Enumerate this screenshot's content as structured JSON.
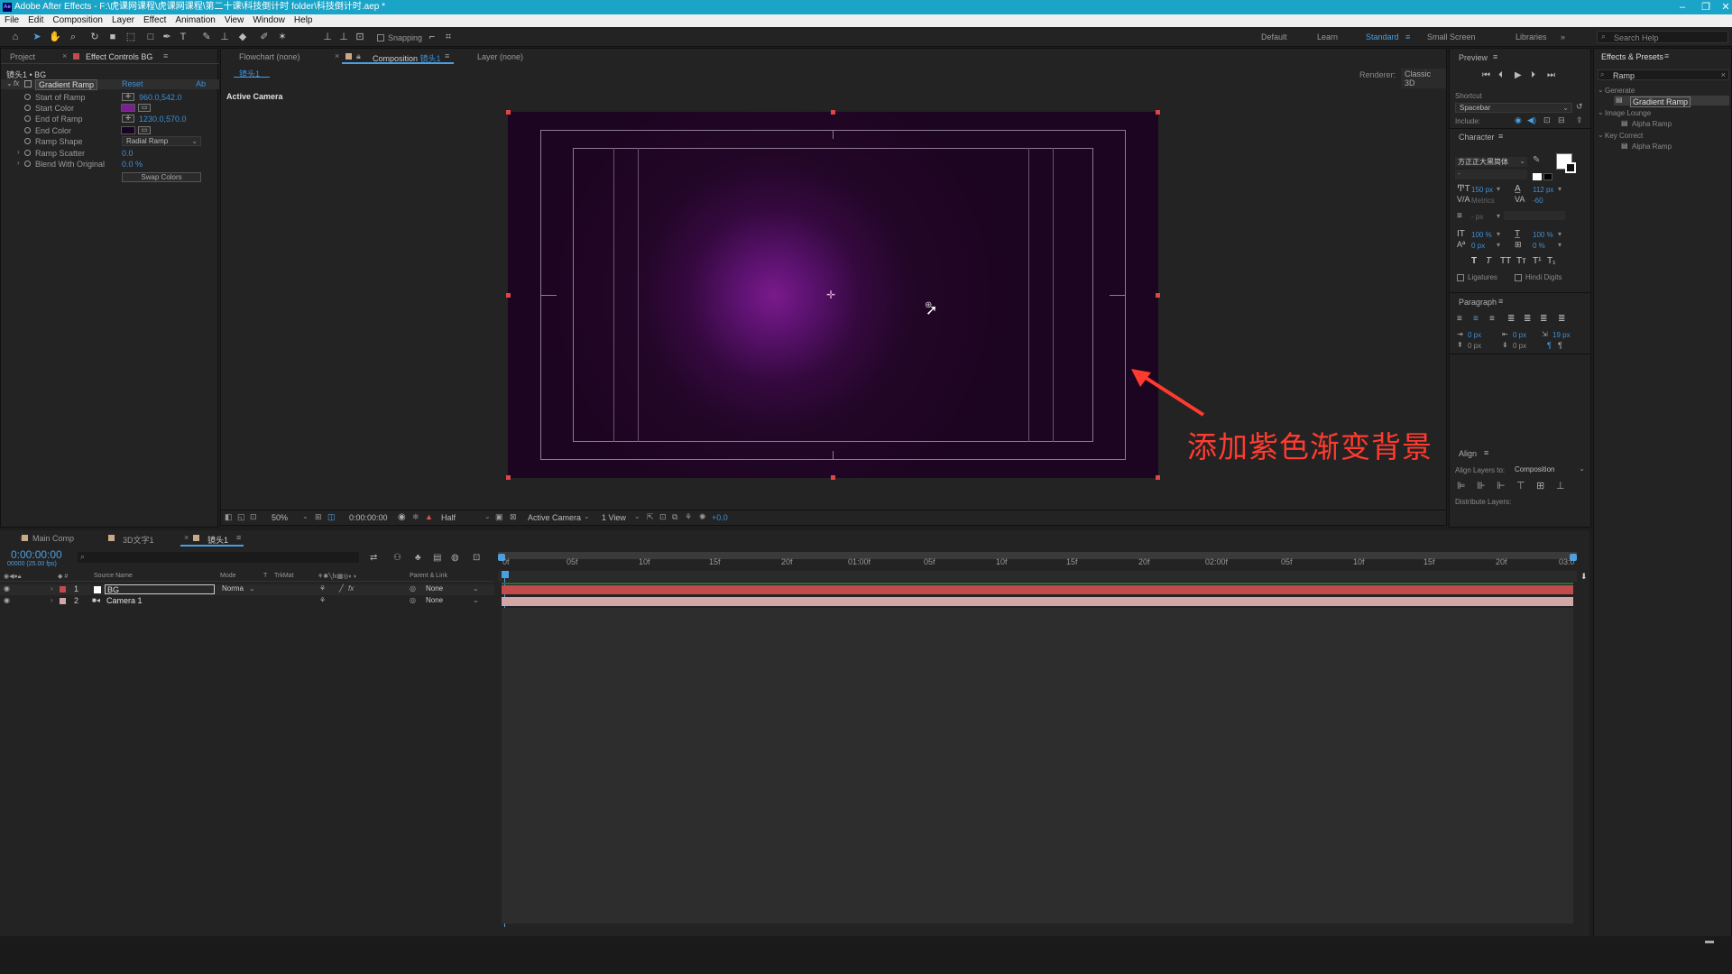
{
  "window": {
    "title": "Adobe After Effects - F:\\虎课网课程\\虎课网课程\\第二十课\\科技倒计时 folder\\科技倒计时.aep *",
    "logo": "Ae"
  },
  "menu": [
    "File",
    "Edit",
    "Composition",
    "Layer",
    "Effect",
    "Animation",
    "View",
    "Window",
    "Help"
  ],
  "toolbar": {
    "snapping_label": "Snapping",
    "workspaces": [
      "Default",
      "Learn",
      "Standard",
      "Small Screen",
      "Libraries"
    ],
    "active_workspace": "Standard",
    "search_help": "Search Help"
  },
  "left_panel": {
    "tabs": [
      "Project",
      "Effect Controls BG"
    ],
    "layer_path": "镜头1 • BG",
    "effect_name": "Gradient Ramp",
    "reset_label": "Reset",
    "about_label": "Ab",
    "properties": [
      {
        "label": "Start of Ramp",
        "value": "960.0,542.0"
      },
      {
        "label": "Start Color",
        "value": ""
      },
      {
        "label": "End of Ramp",
        "value": "1230.0,570.0"
      },
      {
        "label": "End Color",
        "value": ""
      },
      {
        "label": "Ramp Shape",
        "value": "Radial Ramp"
      },
      {
        "label": "Ramp Scatter",
        "value": "0.0"
      },
      {
        "label": "Blend With Original",
        "value": "0.0 %"
      }
    ],
    "swap_colors": "Swap Colors",
    "start_color": "#7d1e96",
    "end_color": "#1a0420"
  },
  "viewer": {
    "tabs": [
      "Flowchart (none)",
      "Composition 镜头1",
      "Layer (none)"
    ],
    "comp_tab": "镜头1",
    "renderer_label": "Renderer:",
    "renderer_value": "Classic 3D",
    "active_camera_label": "Active Camera",
    "footer": {
      "zoom": "50%",
      "timecode": "0:00:00:00",
      "resolution": "Half",
      "camera": "Active Camera",
      "views": "1 View",
      "exposure": "+0.0"
    },
    "annotation": "添加紫色渐变背景"
  },
  "right_panel": {
    "preview_title": "Preview",
    "shortcut_label": "Shortcut",
    "shortcut_value": "Spacebar",
    "include_label": "Include:",
    "character_title": "Character",
    "font_name": "方正正大黑简体",
    "font_style": "-",
    "font_size": "150 px",
    "leading": "112 px",
    "kerning": "Metrics",
    "tracking": "-60",
    "stroke": "- px",
    "vscale": "100 %",
    "hscale": "100 %",
    "baseline": "0 px",
    "tsume": "0 %",
    "style_buttons": [
      "T",
      "T",
      "TT",
      "Tт",
      "T¹",
      "T₁"
    ],
    "ligatures": "Ligatures",
    "hindi_digits": "Hindi Digits",
    "paragraph_title": "Paragraph",
    "para_values": [
      "0 px",
      "0 px",
      "19 px",
      "0 px",
      "0 px"
    ],
    "align_title": "Align",
    "align_to_label": "Align Layers to:",
    "align_to_value": "Composition",
    "distribute_label": "Distribute Layers:"
  },
  "effects_panel": {
    "title": "Effects & Presets",
    "search": "Ramp",
    "tree": [
      {
        "group": "Generate",
        "items": [
          "Gradient Ramp"
        ]
      },
      {
        "group": "Image Lounge",
        "items": [
          "Alpha Ramp"
        ]
      },
      {
        "group": "Key Correct",
        "items": [
          "Alpha Ramp"
        ]
      }
    ],
    "selected": "Gradient Ramp"
  },
  "timeline": {
    "tabs": [
      "Main Comp",
      "3D文字1",
      "镜头1"
    ],
    "active_tab": "镜头1",
    "timecode": "0:00:00:00",
    "fps": "00000 (25.00 fps)",
    "columns": [
      "Source Name",
      "Mode",
      "T",
      "TrkMat",
      "Parent & Link"
    ],
    "layers": [
      {
        "num": "1",
        "name": "BG",
        "mode": "Norma",
        "parent": "None",
        "color": "#c24b4b"
      },
      {
        "num": "2",
        "name": "Camera 1",
        "mode": "",
        "parent": "None",
        "color": "#d2a7a7"
      }
    ],
    "ruler": [
      "0f",
      "05f",
      "10f",
      "15f",
      "20f",
      "01:00f",
      "05f",
      "10f",
      "15f",
      "20f",
      "02:00f",
      "05f",
      "10f",
      "15f",
      "20f",
      "03:0"
    ]
  }
}
